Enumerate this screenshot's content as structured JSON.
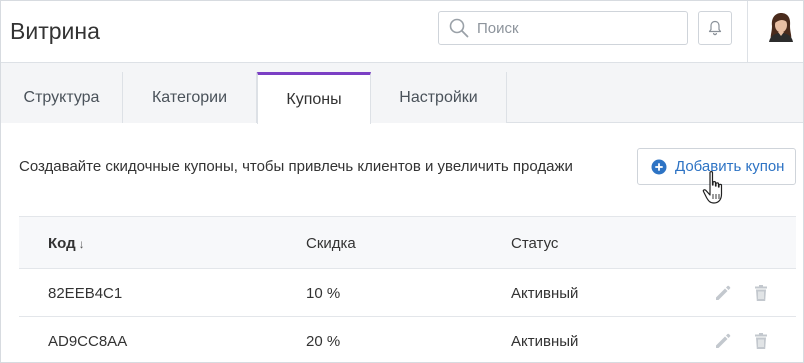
{
  "header": {
    "title": "Витрина",
    "search": {
      "placeholder": "Поиск",
      "value": ""
    }
  },
  "tabs": [
    {
      "label": "Структура",
      "active": false
    },
    {
      "label": "Категории",
      "active": false
    },
    {
      "label": "Купоны",
      "active": true
    },
    {
      "label": "Настройки",
      "active": false
    }
  ],
  "content": {
    "intro": "Создавайте скидочные купоны, чтобы привлечь клиентов и увеличить продажи",
    "add_button_label": "Добавить купон"
  },
  "table": {
    "columns": {
      "code": "Код",
      "code_sort": "↓",
      "discount": "Скидка",
      "status": "Статус"
    },
    "rows": [
      {
        "code": "82EEB4C1",
        "discount": "10 %",
        "status": "Активный"
      },
      {
        "code": "AD9CC8AA",
        "discount": "20 %",
        "status": "Активный"
      }
    ]
  },
  "colors": {
    "accent": "#7b3fc4",
    "link": "#2d73c4",
    "icon_gray": "#c3c8ce"
  },
  "icons": [
    "search-icon",
    "bell-icon",
    "avatar",
    "plus-circle-icon",
    "pointer-cursor-icon",
    "pencil-icon",
    "trash-icon"
  ]
}
